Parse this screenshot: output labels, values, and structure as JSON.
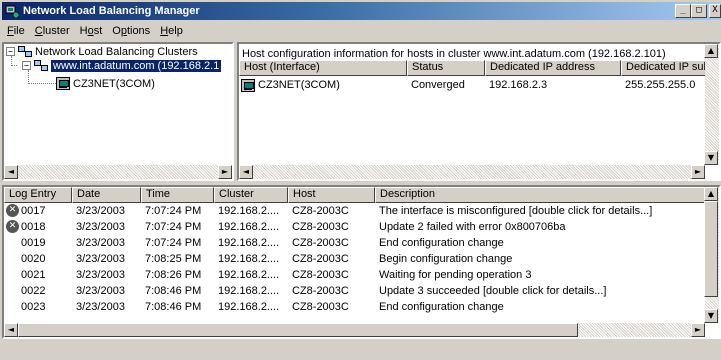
{
  "window": {
    "title": "Network Load Balancing Manager",
    "buttons": [
      "_",
      "□",
      "X"
    ]
  },
  "menubar": {
    "items": [
      {
        "label": "File",
        "mnemonic": "F",
        "rest": "ile"
      },
      {
        "label": "Cluster",
        "mnemonic": "C",
        "rest": "luster"
      },
      {
        "label": "Host",
        "pre": "H",
        "mnemonic": "o",
        "rest": "st"
      },
      {
        "label": "Options",
        "mnemonic": "p",
        "pre": "O",
        "rest": "tions"
      },
      {
        "label": "Help",
        "mnemonic": "H",
        "rest": "elp"
      }
    ]
  },
  "tree": {
    "root": "Network Load Balancing Clusters",
    "cluster": "www.int.adatum.com (192.168.2.1",
    "host": "CZ3NET(3COM)"
  },
  "host_view": {
    "caption": "Host configuration information for hosts in cluster www.int.adatum.com (192.168.2.101)",
    "columns": [
      "Host (Interface)",
      "Status",
      "Dedicated IP address",
      "Dedicated IP subn"
    ],
    "rows": [
      {
        "host": "CZ3NET(3COM)",
        "status": "Converged",
        "ip": "192.168.2.3",
        "subnet": "255.255.255.0"
      }
    ]
  },
  "log_view": {
    "columns": [
      "Log Entry",
      "Date",
      "Time",
      "Cluster",
      "Host",
      "Description"
    ],
    "rows": [
      {
        "entry": "0017",
        "error": true,
        "date": "3/23/2003",
        "time": "7:07:24 PM",
        "cluster": "192.168.2....",
        "host": "CZ8-2003C",
        "description": "The interface is misconfigured [double click for details...]"
      },
      {
        "entry": "0018",
        "error": true,
        "date": "3/23/2003",
        "time": "7:07:24 PM",
        "cluster": "192.168.2....",
        "host": "CZ8-2003C",
        "description": "Update 2 failed with error 0x800706ba"
      },
      {
        "entry": "0019",
        "error": false,
        "date": "3/23/2003",
        "time": "7:07:24 PM",
        "cluster": "192.168.2....",
        "host": "CZ8-2003C",
        "description": "End configuration change"
      },
      {
        "entry": "0020",
        "error": false,
        "date": "3/23/2003",
        "time": "7:08:25 PM",
        "cluster": "192.168.2....",
        "host": "CZ8-2003C",
        "description": "Begin configuration change"
      },
      {
        "entry": "0021",
        "error": false,
        "date": "3/23/2003",
        "time": "7:08:26 PM",
        "cluster": "192.168.2....",
        "host": "CZ8-2003C",
        "description": "Waiting for pending operation 3"
      },
      {
        "entry": "0022",
        "error": false,
        "date": "3/23/2003",
        "time": "7:08:46 PM",
        "cluster": "192.168.2....",
        "host": "CZ8-2003C",
        "description": "Update 3 succeeded [double click for details...]"
      },
      {
        "entry": "0023",
        "error": false,
        "date": "3/23/2003",
        "time": "7:08:46 PM",
        "cluster": "192.168.2....",
        "host": "CZ8-2003C",
        "description": "End configuration change"
      }
    ]
  },
  "icons": {
    "error": "error-icon",
    "scroll_left": "◄",
    "scroll_right": "►",
    "scroll_up": "▲",
    "scroll_down": "▼"
  },
  "colors": {
    "title_start": "#0a246a",
    "title_end": "#a6caf0",
    "selection": "#0a246a",
    "face": "#d4d0c8"
  }
}
